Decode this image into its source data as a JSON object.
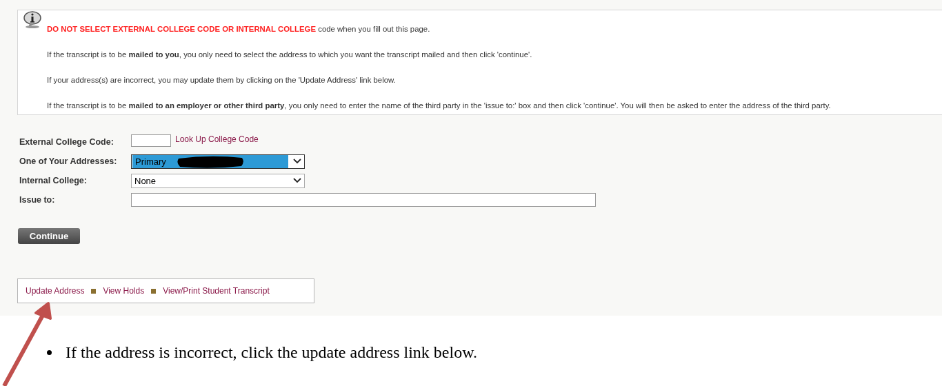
{
  "notice": {
    "paragraphs": [
      "**DO NOT SELECT EXTERNAL COLLEGE CODE OR INTERNAL COLLEGE** code when you fill out this page.",
      "If the transcript is to be **mailed to you**, you only need to select the address to which you want the transcript mailed and then click 'continue'.",
      "If your address(s) are incorrect, you may update them by clicking on the 'Update Address' link below.",
      "If the transcript is to be **mailed to an employer or other third party**, you only need to enter the name of the third party in the 'issue to:' box and then click 'continue'. You will then be asked to enter the address of the third party."
    ]
  },
  "form": {
    "fields": [
      {
        "kind": "code",
        "label": "External College Code:",
        "link": "Look Up College Code"
      },
      {
        "kind": "select",
        "label": "One of Your Addresses:",
        "value": "Primary",
        "highlighted": true,
        "redacted": true
      },
      {
        "kind": "select",
        "label": "Internal College:",
        "value": "None",
        "highlighted": false
      },
      {
        "kind": "text",
        "label": "Issue to:"
      }
    ],
    "button": "Continue"
  },
  "links": [
    "Update Address",
    "View Holds",
    "View/Print Student Transcript"
  ],
  "document": {
    "bullets": [
      "If the address is incorrect, click the update address link below."
    ]
  }
}
